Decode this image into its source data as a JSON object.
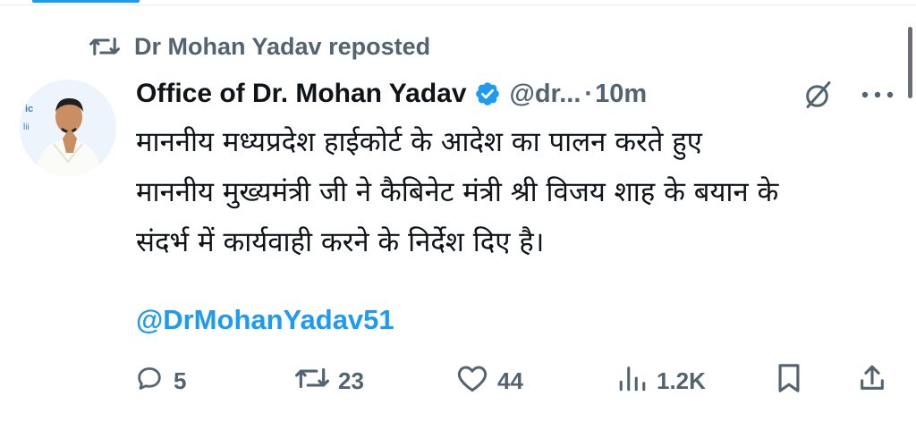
{
  "repost": {
    "icon": "repost-icon",
    "text": "Dr Mohan Yadav reposted"
  },
  "author": {
    "display_name": "Office of Dr. Mohan Yadav",
    "verified_color": "#1d9bf0",
    "handle": "@dr...",
    "separator": "·",
    "time": "10m"
  },
  "tweet": {
    "lines": [
      "माननीय मध्यप्रदेश हाईकोर्ट के आदेश का पालन करते हुए",
      "माननीय मुख्यमंत्री जी ने कैबिनेट मंत्री श्री विजय शाह के बयान के",
      "संदर्भ में कार्यवाही करने के निर्देश दिए है।"
    ],
    "mention": "@DrMohanYadav51"
  },
  "actions": {
    "replies": "5",
    "reposts": "23",
    "likes": "44",
    "views": "1.2K"
  },
  "colors": {
    "accent": "#1d9bf0",
    "muted": "#536471",
    "text": "#0f1419"
  }
}
